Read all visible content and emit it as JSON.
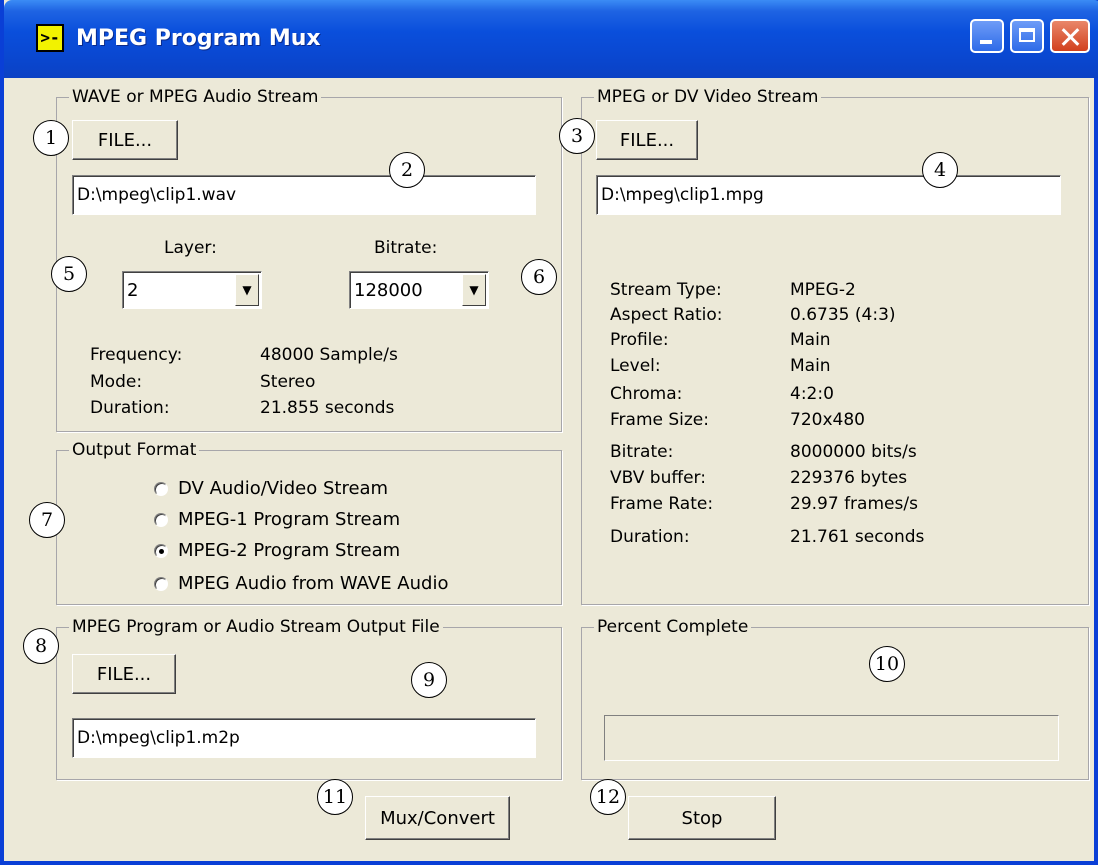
{
  "window": {
    "title": "MPEG Program Mux"
  },
  "audio": {
    "group_label": "WAVE or MPEG Audio Stream",
    "file_button": "FILE...",
    "path": "D:\\mpeg\\clip1.wav",
    "layer_label": "Layer:",
    "layer_value": "2",
    "bitrate_label": "Bitrate:",
    "bitrate_value": "128000",
    "info": [
      {
        "label": "Frequency:",
        "value": "48000 Sample/s"
      },
      {
        "label": "Mode:",
        "value": "Stereo"
      },
      {
        "label": "Duration:",
        "value": "21.855 seconds"
      }
    ]
  },
  "video": {
    "group_label": "MPEG or DV Video Stream",
    "file_button": "FILE...",
    "path": "D:\\mpeg\\clip1.mpg",
    "info": [
      {
        "label": "Stream Type:",
        "value": "MPEG-2"
      },
      {
        "label": "Aspect Ratio:",
        "value": "0.6735 (4:3)"
      },
      {
        "label": "Profile:",
        "value": "Main"
      },
      {
        "label": "Level:",
        "value": "Main"
      },
      {
        "label": "Chroma:",
        "value": "4:2:0"
      },
      {
        "label": "Frame Size:",
        "value": "720x480"
      },
      {
        "label": "Bitrate:",
        "value": "8000000 bits/s"
      },
      {
        "label": "VBV buffer:",
        "value": "229376 bytes"
      },
      {
        "label": "Frame Rate:",
        "value": "29.97 frames/s"
      },
      {
        "label": "Duration:",
        "value": "21.761 seconds"
      }
    ]
  },
  "output_format": {
    "group_label": "Output Format",
    "options": [
      {
        "label": "DV Audio/Video Stream",
        "selected": false
      },
      {
        "label": "MPEG-1 Program Stream",
        "selected": false
      },
      {
        "label": "MPEG-2 Program Stream",
        "selected": true
      },
      {
        "label": "MPEG Audio from WAVE Audio",
        "selected": false
      }
    ]
  },
  "output_file": {
    "group_label": "MPEG Program or Audio Stream Output File",
    "file_button": "FILE...",
    "path": "D:\\mpeg\\clip1.m2p"
  },
  "progress": {
    "group_label": "Percent Complete",
    "percent": 0
  },
  "actions": {
    "mux_label": "Mux/Convert",
    "stop_label": "Stop"
  },
  "callouts": [
    "1",
    "2",
    "3",
    "4",
    "5",
    "6",
    "7",
    "8",
    "9",
    "10",
    "11",
    "12"
  ],
  "colors": {
    "titlebar": "#0a4fdc",
    "dialog_bg": "#ece9d8",
    "progress_fill": "#316ac5"
  },
  "icons": {
    "app": "mux-app-icon",
    "minimize": "minimize-icon",
    "maximize": "maximize-icon",
    "close": "close-icon",
    "dropdown": "chevron-down-icon"
  }
}
